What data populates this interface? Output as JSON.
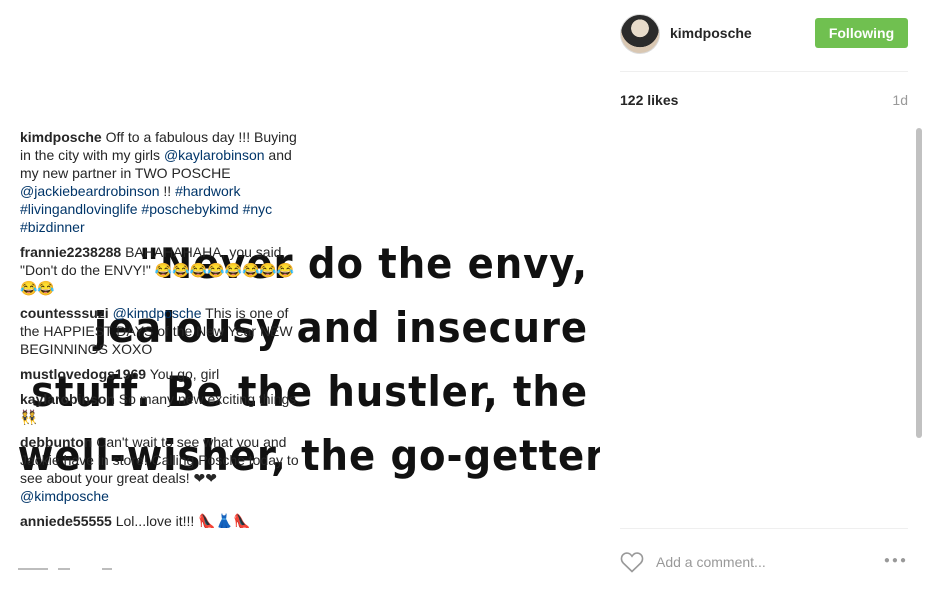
{
  "post": {
    "quote_lines": [
      "\"Never do the envy,",
      "jealousy and insecure",
      "stuff. Be the hustler, the",
      "well-wisher, the go-getter.\""
    ]
  },
  "header": {
    "username": "kimdposche",
    "follow_label": "Following",
    "follow_color": "#70c050"
  },
  "stats": {
    "likes": "122 likes",
    "age": "1d"
  },
  "caption": {
    "author": "kimdposche",
    "parts": [
      {
        "t": " Off to a fabulous day !!! Buying in the city with my girls ",
        "link": false
      },
      {
        "t": "@kaylarobinson",
        "link": true
      },
      {
        "t": " and my new partner in TWO POSCHE ",
        "link": false
      },
      {
        "t": "@jackiebeardrobinson",
        "link": true
      },
      {
        "t": " !! ",
        "link": false
      },
      {
        "t": "#hardwork",
        "link": true
      },
      {
        "t": " ",
        "link": false
      },
      {
        "t": "#livingandlovinglife",
        "link": true
      },
      {
        "t": " ",
        "link": false
      },
      {
        "t": "#poschebykimd",
        "link": true
      },
      {
        "t": " ",
        "link": false
      },
      {
        "t": "#nyc",
        "link": true
      },
      {
        "t": " ",
        "link": false
      },
      {
        "t": "#bizdinner",
        "link": true
      }
    ]
  },
  "comments": [
    {
      "author": "frannie2238288",
      "parts": [
        {
          "t": " BAHAHAHAHA, you said, \"Don't do the ENVY!\" 😂😂😂😂😂😂😂😂😂😂",
          "link": false
        }
      ]
    },
    {
      "author": "countesssuzi",
      "parts": [
        {
          "t": " ",
          "link": false
        },
        {
          "t": "@kimdposche",
          "link": true
        },
        {
          "t": " This is one of the HAPPIEST DAYS of the New Year NEW BEGINNINGS XOXO",
          "link": false
        }
      ]
    },
    {
      "author": "mustlovedogs1969",
      "parts": [
        {
          "t": " You go, girl",
          "link": false
        }
      ]
    },
    {
      "author": "kaylarobinson",
      "parts": [
        {
          "t": " So many new exciting things 👯",
          "link": false
        }
      ]
    },
    {
      "author": "debbunton",
      "parts": [
        {
          "t": " Can't wait to see what you and Jackie have in store! Calling Posche today to see about your great deals! ❤❤ ",
          "link": false
        },
        {
          "t": "@kimdposche",
          "link": true
        }
      ]
    },
    {
      "author": "anniede55555",
      "parts": [
        {
          "t": " Lol...love it!!! 👠👗👠",
          "link": false
        }
      ]
    }
  ],
  "footer": {
    "comment_placeholder": "Add a comment...",
    "heart_icon": "heart-outline-icon",
    "more_icon": "ellipsis-icon"
  }
}
